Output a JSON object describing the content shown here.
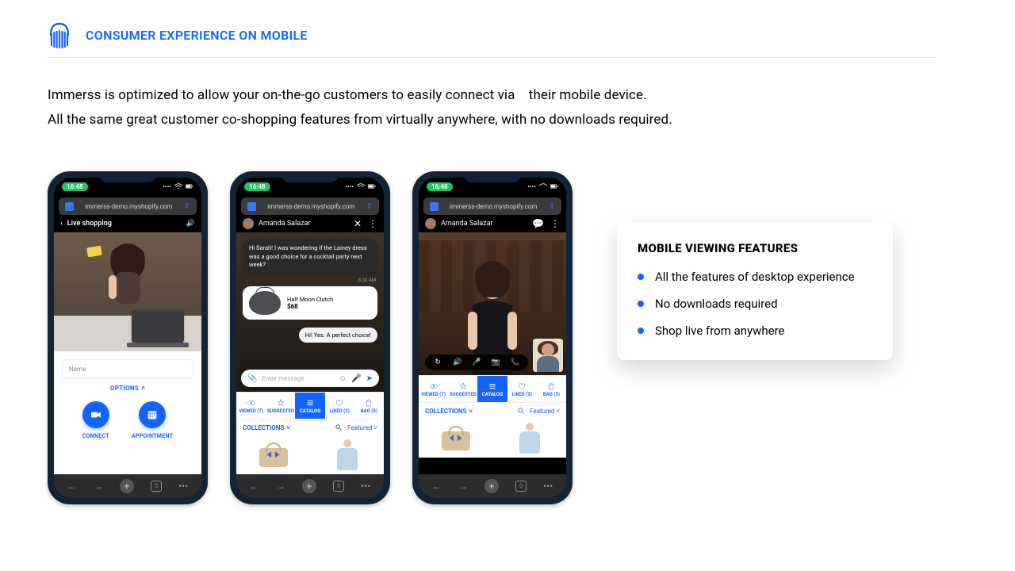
{
  "header": {
    "title": "CONSUMER EXPERIENCE ON MOBILE"
  },
  "intro": {
    "line1": "Immerss is optimized to allow your on-the-go customers to easily connect via    their mobile device.",
    "line2": "All the same great customer co-shopping features from virtually anywhere, with no downloads required."
  },
  "statusbar_time": "16:48",
  "url_bar": "immerss-demo.myshopify.com",
  "bottom_nav_tabs_count": "0",
  "phone1": {
    "header_title": "Live shopping",
    "name_placeholder": "Name",
    "options_label": "OPTIONS",
    "connect_label": "CONNECT",
    "appointment_label": "APPOINTMENT"
  },
  "phone2": {
    "host_name": "Amanda Salazar",
    "msg1": "Hi Sarah!  I was wondering if the Lainey dress was a good choice for a cocktail party next week?",
    "timestamp": "8:30 AM",
    "product_name": "Half Moon Clutch",
    "product_price": "$68",
    "reply": "Hi!  Yes.  A perfect choice!",
    "placeholder": "Enter message"
  },
  "phone3": {
    "host_name": "Amanda Salazar"
  },
  "catalog_tabs": {
    "viewed": "VIEWED (7)",
    "suggested": "SUGGESTED",
    "catalog": "CATALOG",
    "liked": "LIKED (3)",
    "bag": "BAG (5)"
  },
  "collections": {
    "label": "COLLECTIONS",
    "featured": "Featured"
  },
  "feature_card": {
    "title": "MOBILE VIEWING FEATURES",
    "items": [
      "All the features of desktop experience",
      "No downloads required",
      "Shop live from anywhere"
    ]
  }
}
